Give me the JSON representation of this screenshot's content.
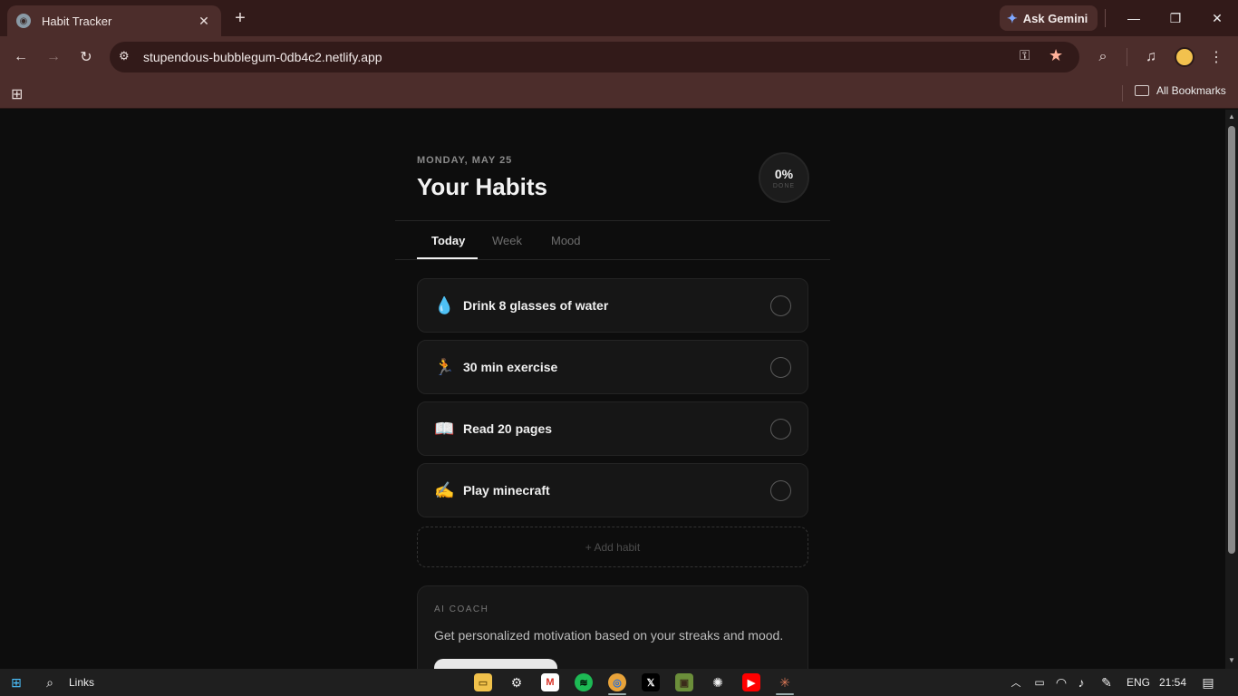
{
  "browser": {
    "tab_title": "Habit Tracker",
    "gemini_label": "Ask Gemini",
    "url": "stupendous-bubblegum-0db4c2.netlify.app",
    "bookmarks_all": "All Bookmarks"
  },
  "page": {
    "date": "MONDAY, MAY 25",
    "title": "Your Habits",
    "progress": {
      "percent": "0%",
      "label": "DONE",
      "value": 0
    },
    "tabs": [
      {
        "label": "Today",
        "active": true
      },
      {
        "label": "Week",
        "active": false
      },
      {
        "label": "Mood",
        "active": false
      }
    ],
    "habits": [
      {
        "emoji": "💧",
        "name": "Drink 8 glasses of water",
        "done": false
      },
      {
        "emoji": "🏃",
        "name": "30 min exercise",
        "done": false
      },
      {
        "emoji": "📖",
        "name": "Read 20 pages",
        "done": false
      },
      {
        "emoji": "✍️",
        "name": "Play minecraft",
        "done": false
      }
    ],
    "add_habit_label": "+ Add habit",
    "coach": {
      "label": "AI COACH",
      "description": "Get personalized motivation based on your streaks and mood."
    }
  },
  "taskbar": {
    "search_label": "Links",
    "language": "ENG",
    "time": "21:54"
  }
}
